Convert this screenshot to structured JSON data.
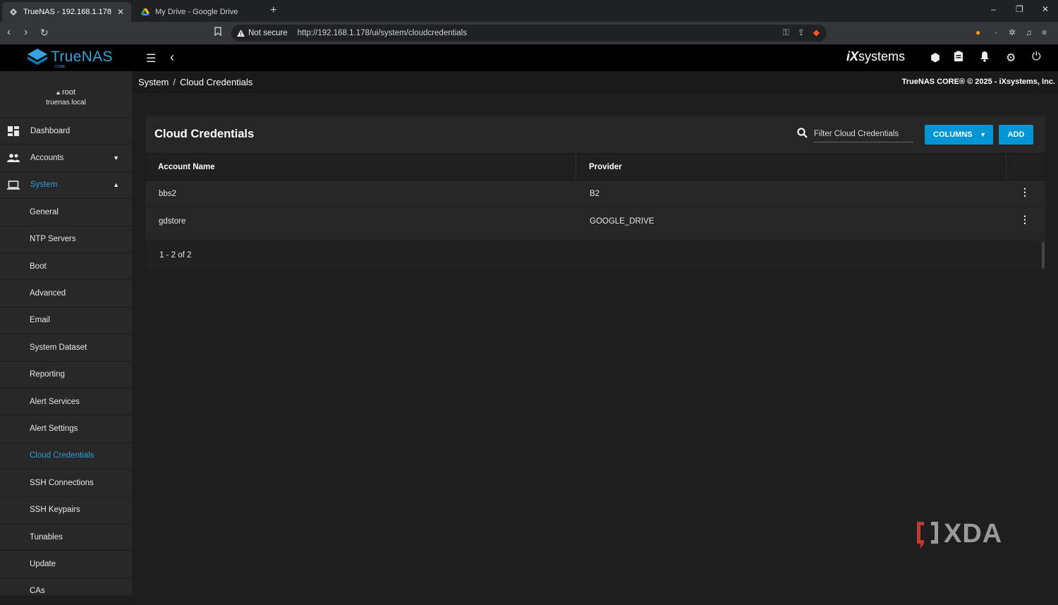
{
  "browser": {
    "tabs": [
      {
        "title": "TrueNAS - 192.168.1.178",
        "active": true
      },
      {
        "title": "My Drive - Google Drive",
        "active": false
      }
    ],
    "new_tab_label": "+",
    "security_label": "Not secure",
    "url": "http://192.168.1.178/ui/system/cloudcredentials",
    "window_controls": {
      "minimize": "–",
      "restore": "❐",
      "close": "✕"
    }
  },
  "app": {
    "logo_text": "TrueNAS",
    "logo_sub": "CORE",
    "vendor": "iX",
    "vendor_suffix": "systems",
    "accent_color": "#0095d5"
  },
  "breadcrumb": {
    "parent": "System",
    "separator": "/",
    "current": "Cloud Credentials"
  },
  "copyright": "TrueNAS CORE® © 2025 - iXsystems, Inc.",
  "user": {
    "name": "root",
    "host": "truenas.local"
  },
  "sidebar": {
    "items": [
      {
        "label": "Dashboard",
        "icon": "dashboard-icon"
      },
      {
        "label": "Accounts",
        "icon": "people-icon"
      },
      {
        "label": "System",
        "icon": "laptop-icon"
      }
    ],
    "sub_items": [
      "General",
      "NTP Servers",
      "Boot",
      "Advanced",
      "Email",
      "System Dataset",
      "Reporting",
      "Alert Services",
      "Alert Settings",
      "Cloud Credentials",
      "SSH Connections",
      "SSH Keypairs",
      "Tunables",
      "Update",
      "CAs"
    ],
    "active_sub": "Cloud Credentials"
  },
  "card": {
    "title": "Cloud Credentials",
    "filter_placeholder": "Filter Cloud Credentials",
    "columns_button": "COLUMNS",
    "add_button": "ADD",
    "headers": [
      "Account Name",
      "Provider"
    ],
    "rows": [
      {
        "name": "bbs2",
        "provider": "B2"
      },
      {
        "name": "gdstore",
        "provider": "GOOGLE_DRIVE"
      }
    ],
    "pager": "1 - 2 of 2"
  },
  "watermark": "XDA"
}
